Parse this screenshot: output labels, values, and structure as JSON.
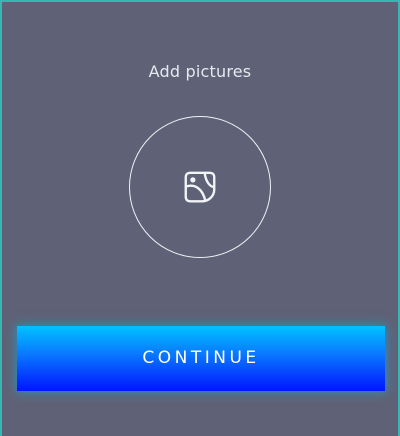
{
  "page": {
    "title": "Add pictures"
  },
  "picker": {
    "icon": "image-placeholder-icon"
  },
  "actions": {
    "continue_label": "CONTINUE"
  },
  "colors": {
    "background": "#5f6276",
    "border_accent": "#35b8b1",
    "button_top": "#00c2ff",
    "button_bottom": "#0016ff",
    "text": "#e7e8ef"
  }
}
